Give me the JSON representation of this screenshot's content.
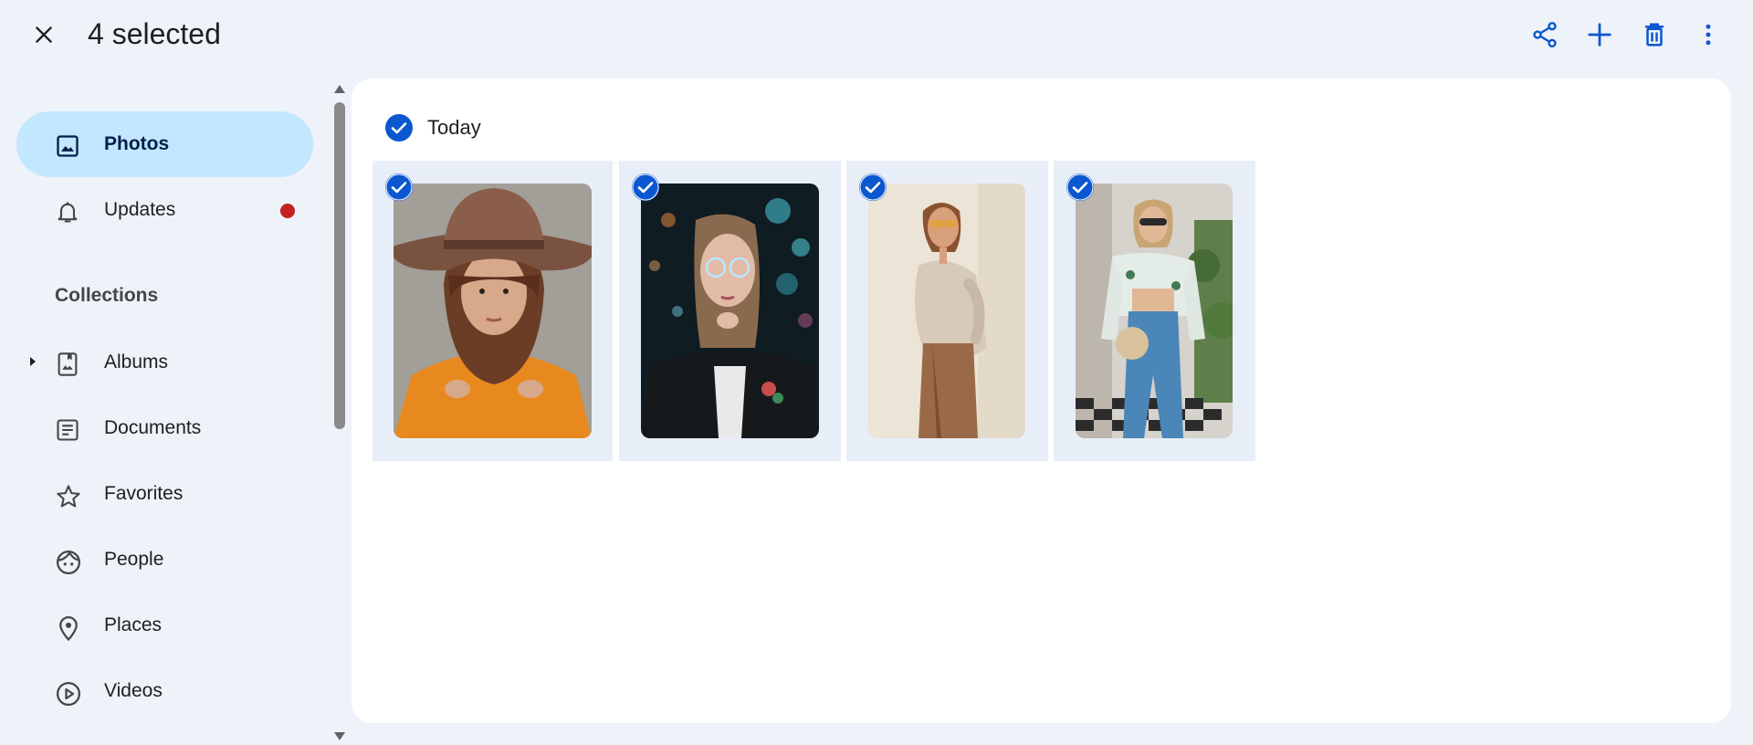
{
  "header": {
    "selection_title": "4 selected",
    "icons": [
      "close-icon",
      "share-icon",
      "add-icon",
      "delete-icon",
      "more-vert-icon"
    ],
    "accent": "#0b57d0"
  },
  "sidebar": {
    "items": [
      {
        "label": "Photos",
        "icon": "photo-icon",
        "active": true
      },
      {
        "label": "Updates",
        "icon": "bell-icon",
        "badge": true
      }
    ],
    "collections_heading": "Collections",
    "collections": [
      {
        "label": "Albums",
        "icon": "album-icon",
        "expandable": true
      },
      {
        "label": "Documents",
        "icon": "document-icon"
      },
      {
        "label": "Favorites",
        "icon": "star-icon"
      },
      {
        "label": "People",
        "icon": "face-icon"
      },
      {
        "label": "Places",
        "icon": "location-pin-icon"
      },
      {
        "label": "Videos",
        "icon": "play-circle-icon"
      }
    ],
    "active_color": "#c2e7ff",
    "badge_color": "#c5221f"
  },
  "main": {
    "date_group": "Today",
    "photos": [
      {
        "description": "woman in brown hat and orange sweater",
        "selected": true
      },
      {
        "description": "woman in glasses with leather jacket at night",
        "selected": true
      },
      {
        "description": "woman in sunglasses with beige shirt",
        "selected": true
      },
      {
        "description": "woman in floral top and denim skirt",
        "selected": true
      }
    ]
  }
}
